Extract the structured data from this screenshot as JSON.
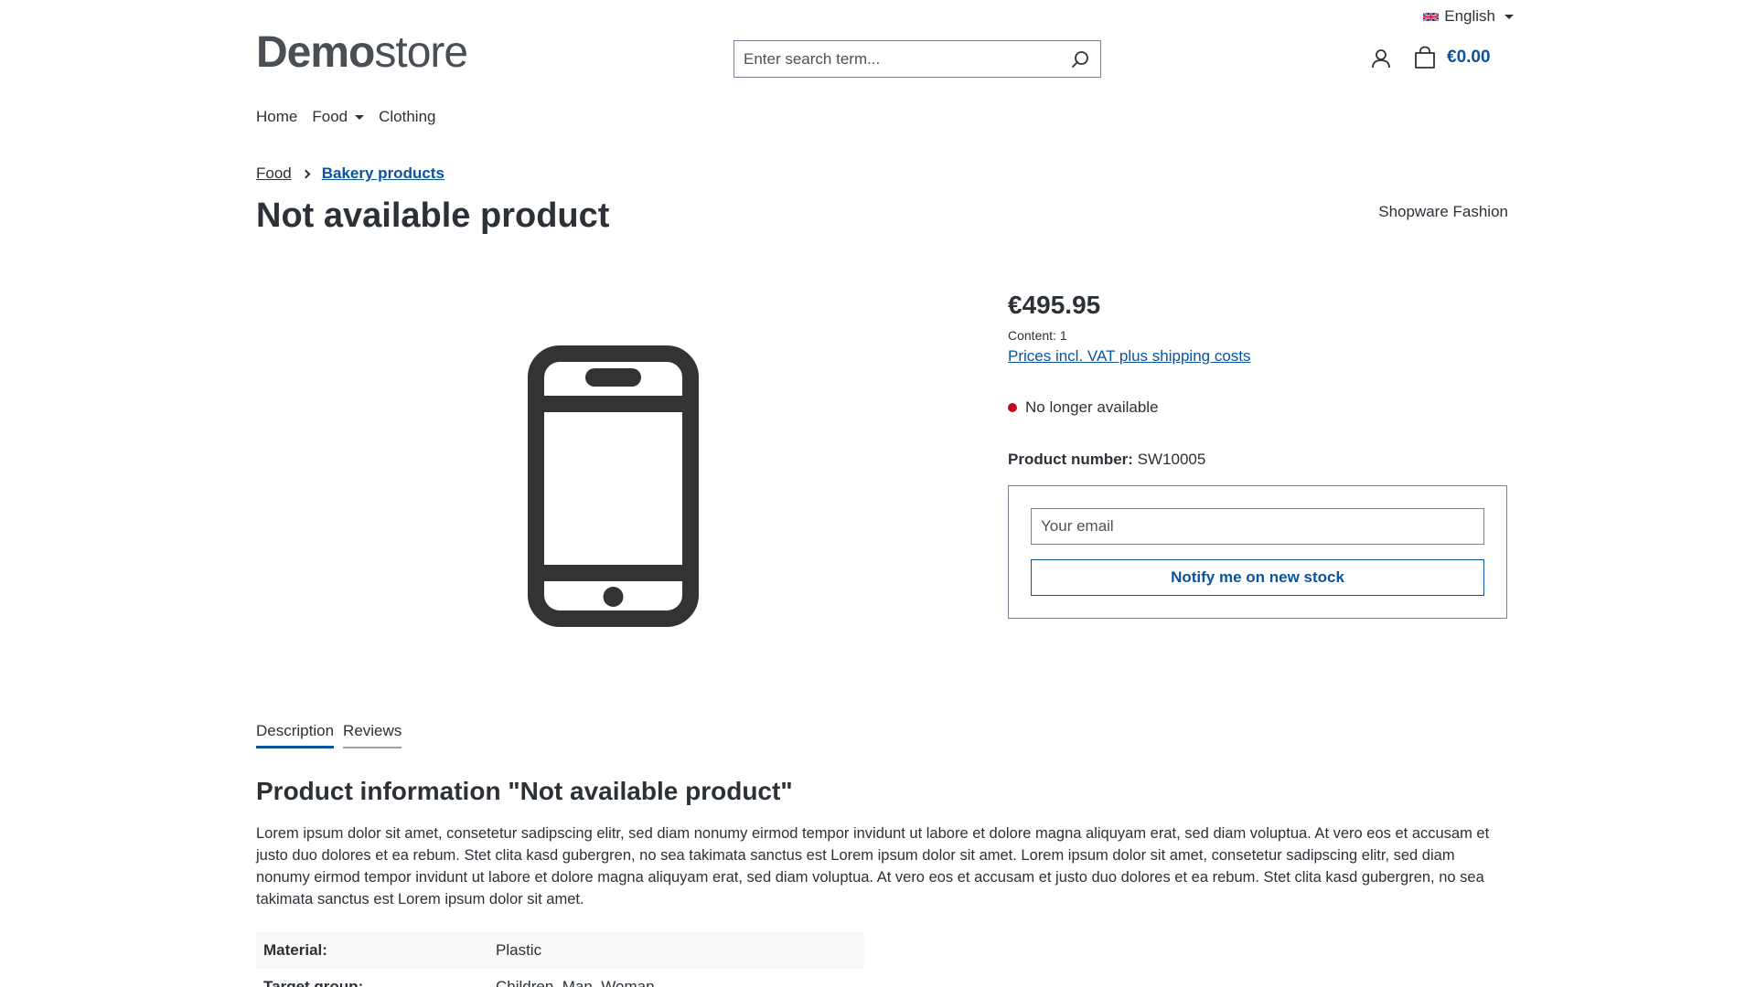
{
  "top_bar": {
    "language": "English"
  },
  "header": {
    "logo_strong": "Demo",
    "logo_light": "store",
    "search_placeholder": "Enter search term...",
    "cart_total": "€0.00"
  },
  "nav": {
    "items": [
      {
        "label": "Home",
        "has_dropdown": false
      },
      {
        "label": "Food",
        "has_dropdown": true
      },
      {
        "label": "Clothing",
        "has_dropdown": false
      }
    ]
  },
  "breadcrumb": {
    "items": [
      {
        "label": "Food",
        "active": false
      },
      {
        "label": "Bakery products",
        "active": true
      }
    ]
  },
  "product": {
    "title": "Not available product",
    "manufacturer": "Shopware Fashion",
    "image_icon": "smartphone-icon",
    "price": "€495.95",
    "content": "Content: 1",
    "vat_link": "Prices incl. VAT plus shipping costs",
    "availability": "No longer available",
    "availability_color": "#c30a1f",
    "product_number_label": "Product number:",
    "product_number_value": " SW10005"
  },
  "notify": {
    "email_placeholder": "Your email",
    "button_label": "Notify me on new stock"
  },
  "tabs": [
    {
      "label": "Description",
      "active": true
    },
    {
      "label": "Reviews",
      "active": false
    }
  ],
  "description": {
    "heading": "Product information \"Not available product\"",
    "text": "Lorem ipsum dolor sit amet, consetetur sadipscing elitr, sed diam nonumy eirmod tempor invidunt ut labore et dolore magna aliquyam erat, sed diam voluptua. At vero eos et accusam et justo duo dolores et ea rebum. Stet clita kasd gubergren, no sea takimata sanctus est Lorem ipsum dolor sit amet. Lorem ipsum dolor sit amet, consetetur sadipscing elitr, sed diam nonumy eirmod tempor invidunt ut labore et dolore magna aliquyam erat, sed diam voluptua. At vero eos et accusam et justo duo dolores et ea rebum. Stet clita kasd gubergren, no sea takimata sanctus est Lorem ipsum dolor sit amet."
  },
  "properties": [
    {
      "label": "Material:",
      "value": "Plastic"
    },
    {
      "label": "Target group:",
      "value": "Children, Man, Woman"
    }
  ],
  "colors": {
    "accent": "#0b539b",
    "text": "#2b3136",
    "border": "#798490"
  }
}
